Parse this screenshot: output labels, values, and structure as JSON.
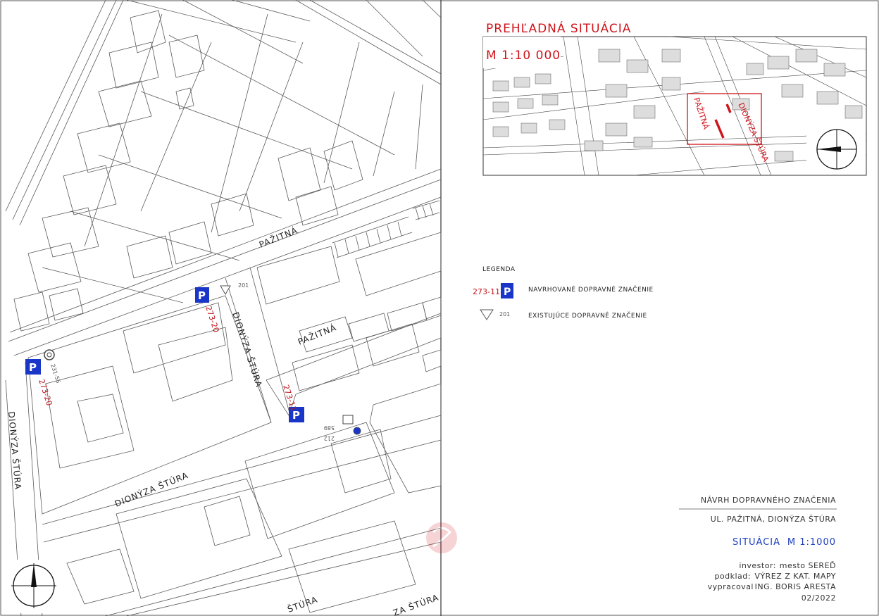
{
  "overview": {
    "title": "PREHĽADNÁ SITUÁCIA",
    "scale": "M 1:10 000",
    "labels": [
      "PAŽITNÁ",
      "DIONÝZA ŠTÚRA"
    ]
  },
  "legend": {
    "heading": "LEGENDA",
    "items": [
      {
        "code": "273-11",
        "text": "NAVRHOVANÉ DOPRAVNÉ ZNAČENIE",
        "icon": "parking-sign-icon"
      },
      {
        "code": "201",
        "text": "EXISTUJÚCE DOPRAVNÉ ZNAČENIE",
        "icon": "yield-triangle-icon"
      }
    ]
  },
  "map": {
    "streets": {
      "pazitna_top": "PAŽITNÁ",
      "pazitna_mid": "PAŽITNÁ",
      "dionyza_vertical": "DIONÝZA ŠTÚRA",
      "dionyza_left": "DIONÝZA ŠTÚRA",
      "dionyza_bottom": "DIONÝZA ŠTÚRA",
      "dionyza_fragment1": "ŠTÚRA",
      "dionyza_fragment2": "ZA ŠTÚRA"
    },
    "signs": {
      "sign_a": "273-20",
      "sign_b": "273-20",
      "sign_c": "273-11",
      "existing_201": "201",
      "existing_231": "231-55",
      "small_589": "589",
      "small_212": "212"
    }
  },
  "title_block": {
    "project": "NÁVRH DOPRAVNÉHO ZNAČENIA",
    "location": "UL. PAŽITNÁ, DIONÝZA ŠTÚRA",
    "drawing": "SITUÁCIA",
    "scale": "M 1:1000",
    "investor_label": "investor:",
    "investor": "mesto SEREĎ",
    "basis_label": "podklad:",
    "basis": "VÝREZ Z KAT. MAPY",
    "author_label": "vypracoval",
    "author": "ING. BORIS ARESTA",
    "date": "02/2022"
  },
  "colors": {
    "sign_blue": "#1a36c8",
    "code_red": "#c0141b",
    "line_gray": "#666666"
  }
}
